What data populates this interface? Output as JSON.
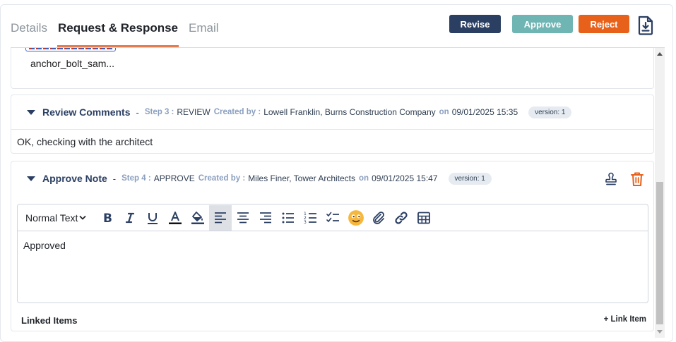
{
  "header": {
    "tabs": [
      {
        "label": "Details",
        "active": false
      },
      {
        "label": "Request & Response",
        "active": true
      },
      {
        "label": "Email",
        "active": false
      }
    ],
    "buttons": {
      "revise": "Revise",
      "approve": "Approve",
      "reject": "Reject"
    },
    "download_icon": "download-document-icon"
  },
  "attachment": {
    "file_name": "anchor_bolt_sam..."
  },
  "review_comment": {
    "title": "Review Comments",
    "step_label": "Step 3 :",
    "step_value": "REVIEW",
    "created_label": "Created by :",
    "created_value": "Lowell Franklin, Burns Construction Company",
    "on_label": "on",
    "date": "09/01/2025 15:35",
    "version": "version: 1",
    "body": "OK, checking with the architect"
  },
  "approve_note": {
    "title": "Approve Note",
    "step_label": "Step 4 :",
    "step_value": "APPROVE",
    "created_label": "Created by :",
    "created_value": "Miles Finer, Tower Architects",
    "on_label": "on",
    "date": "09/01/2025 15:47",
    "version": "version: 1",
    "editor": {
      "format_select": "Normal Text",
      "content": "Approved",
      "toolbar": [
        "bold",
        "italic",
        "underline",
        "text-color",
        "highlight",
        "align-left",
        "align-center",
        "align-right",
        "bullet-list",
        "numbered-list",
        "checklist",
        "emoji",
        "attachment",
        "link",
        "table"
      ],
      "active_tool": "align-left"
    },
    "linked_items_label": "Linked Items",
    "link_item_button": "+ Link Item"
  },
  "colors": {
    "revise": "#2b3f63",
    "approve": "#6fb5b4",
    "reject": "#e8611a",
    "active_tab_underline": "#e57b4f",
    "trash": "#e8611a"
  }
}
